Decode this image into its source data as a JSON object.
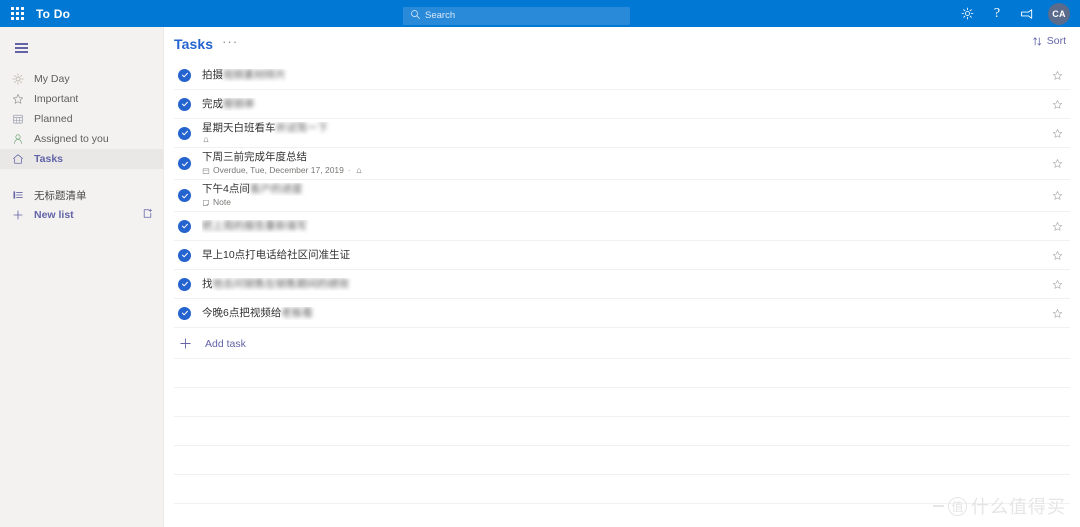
{
  "header": {
    "app_title": "To Do",
    "waffle_icon": "app-launcher-grid-icon",
    "search": {
      "placeholder": "Search",
      "value": "",
      "icon": "search-icon"
    },
    "actions": [
      {
        "name": "settings",
        "icon": "gear-icon"
      },
      {
        "name": "help",
        "icon": "question-mark-icon",
        "glyph": "?"
      },
      {
        "name": "feedback",
        "icon": "megaphone-icon"
      }
    ],
    "avatar": {
      "initials": "CA",
      "icon": "avatar"
    },
    "accent_color": "#0078d4"
  },
  "sidebar": {
    "menu_toggle": {
      "label": "",
      "icon": "hamburger-menu-icon"
    },
    "items": [
      {
        "label": "My Day",
        "icon": "sun-icon",
        "selected": false
      },
      {
        "label": "Important",
        "icon": "star-icon",
        "selected": false
      },
      {
        "label": "Planned",
        "icon": "calendar-icon",
        "selected": false
      },
      {
        "label": "Assigned to you",
        "icon": "person-icon",
        "selected": false
      },
      {
        "label": "Tasks",
        "icon": "home-icon",
        "selected": true
      }
    ],
    "lists": [
      {
        "label": "无标题清单",
        "icon": "list-icon"
      }
    ],
    "new_list": {
      "label": "New list",
      "icon": "plus-icon"
    },
    "new_group": {
      "icon": "new-group-icon"
    },
    "selected_color": "#6264a7",
    "background_color": "#f3f2f1"
  },
  "main": {
    "title": "Tasks",
    "title_color": "#2564cf",
    "more_options": {
      "label": "···",
      "icon": "more-options-icon"
    },
    "sort": {
      "label": "Sort",
      "icon": "sort-arrows-icon"
    },
    "tasks": [
      {
        "title": "拍摄",
        "title_blurred_suffix": "视频素材样片",
        "completed": true,
        "starred": false,
        "meta": []
      },
      {
        "title": "完成",
        "title_blurred_suffix": "报销单",
        "completed": true,
        "starred": false,
        "meta": []
      },
      {
        "title": "星期天白班看车",
        "title_blurred_suffix": "并试驾一下",
        "completed": true,
        "starred": false,
        "meta": [
          {
            "icon": "reminder-bell-icon",
            "text": ""
          }
        ]
      },
      {
        "title": "下周三前完成年度总结",
        "title_blurred_suffix": "",
        "completed": true,
        "starred": false,
        "meta": [
          {
            "icon": "calendar-icon",
            "text": "Overdue, Tue, December 17, 2019"
          },
          {
            "icon": "reminder-bell-icon",
            "text": ""
          }
        ]
      },
      {
        "title": "下午4点间",
        "title_blurred_suffix": "客户的进度",
        "completed": true,
        "starred": false,
        "meta": [
          {
            "icon": "note-icon",
            "text": "Note"
          }
        ]
      },
      {
        "title": "",
        "title_blurred_suffix": "把上周的报告重新填写",
        "completed": true,
        "starred": false,
        "meta": []
      },
      {
        "title": "早上10点打电话给社区问准生证",
        "title_blurred_suffix": "",
        "completed": true,
        "starred": false,
        "meta": []
      },
      {
        "title": "找",
        "title_blurred_suffix": "他去问销售在销售期间的绩效",
        "completed": true,
        "starred": false,
        "meta": []
      },
      {
        "title": "今晚6点把视频给",
        "title_blurred_suffix": "老板看",
        "completed": true,
        "starred": false,
        "meta": []
      }
    ],
    "add_task": {
      "label": "Add task",
      "icon": "plus-icon"
    },
    "empty_rows": 5,
    "check_color": "#2564cf"
  },
  "watermark": {
    "mark": "值",
    "text": "什么值得买"
  }
}
